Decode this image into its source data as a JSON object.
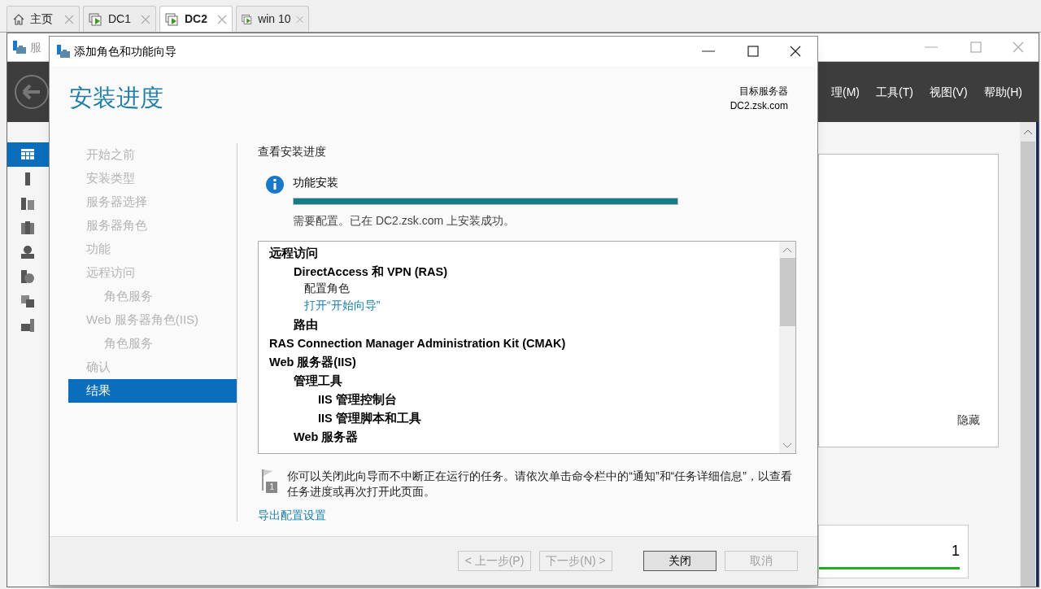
{
  "tabs": [
    {
      "label": "主页",
      "kind": "home",
      "selected": false
    },
    {
      "label": "DC1",
      "kind": "vm",
      "selected": false
    },
    {
      "label": "DC2",
      "kind": "vm",
      "selected": true
    },
    {
      "label": "win 10",
      "kind": "vm",
      "selected": false
    }
  ],
  "background_window": {
    "title": "服",
    "menu": [
      "理(M)",
      "工具(T)",
      "视图(V)",
      "帮助(H)"
    ],
    "sidebar": [
      {
        "kind": "dashboard",
        "selected": true
      },
      {
        "kind": "server",
        "selected": false
      },
      {
        "kind": "servers",
        "selected": false
      },
      {
        "kind": "ad",
        "selected": false
      },
      {
        "kind": "dns",
        "selected": false
      },
      {
        "kind": "iis",
        "selected": false
      },
      {
        "kind": "files",
        "selected": false
      },
      {
        "kind": "remote",
        "selected": false
      }
    ],
    "card_link": "隐藏",
    "count_tile": {
      "value": "1",
      "level": 1
    }
  },
  "wizard": {
    "title": "添加角色和功能向导",
    "heading": "安装进度",
    "target_label": "目标服务器",
    "target_server": "DC2.zsk.com",
    "steps": [
      {
        "label": "开始之前",
        "selected": false
      },
      {
        "label": "安装类型",
        "selected": false
      },
      {
        "label": "服务器选择",
        "selected": false
      },
      {
        "label": "服务器角色",
        "selected": false
      },
      {
        "label": "功能",
        "selected": false
      },
      {
        "label": "远程访问",
        "selected": false,
        "children": [
          {
            "label": "角色服务",
            "selected": false
          }
        ]
      },
      {
        "label": "Web 服务器角色(IIS)",
        "selected": false,
        "children": [
          {
            "label": "角色服务",
            "selected": false
          }
        ]
      },
      {
        "label": "确认",
        "selected": false
      },
      {
        "label": "结果",
        "selected": true
      }
    ],
    "section_title": "查看安装进度",
    "progress": {
      "label": "功能安装",
      "level": 1,
      "message": "需要配置。已在 DC2.zsk.com 上安装成功。"
    },
    "results": [
      {
        "text": "远程访问",
        "kind": "bold",
        "children": [
          {
            "text": "DirectAccess 和 VPN (RAS)",
            "kind": "bold",
            "children": [
              {
                "text": "配置角色",
                "kind": "text"
              },
              {
                "text": "打开“开始向导”",
                "kind": "link"
              }
            ]
          },
          {
            "text": "路由",
            "kind": "bold"
          }
        ]
      },
      {
        "text": "RAS Connection Manager Administration Kit (CMAK)",
        "kind": "bold"
      },
      {
        "text": "Web 服务器(IIS)",
        "kind": "bold",
        "children": [
          {
            "text": "管理工具",
            "kind": "bold",
            "children": [
              {
                "text": "IIS 管理控制台",
                "kind": "bold"
              },
              {
                "text": "IIS 管理脚本和工具",
                "kind": "bold"
              }
            ]
          },
          {
            "text": "Web 服务器",
            "kind": "bold"
          }
        ]
      }
    ],
    "notice": {
      "badge": "1",
      "text": "你可以关闭此向导而不中断正在运行的任务。请依次单击命令栏中的“通知”和“任务详细信息”，以查看任务进度或再次打开此页面。"
    },
    "export_link": "导出配置设置",
    "buttons": [
      {
        "label": "< 上一步(P)",
        "disabled": true,
        "default": false
      },
      {
        "label": "下一步(N) >",
        "disabled": true,
        "default": false
      },
      {
        "label": "关闭",
        "disabled": false,
        "default": true
      },
      {
        "label": "取消",
        "disabled": true,
        "default": false
      }
    ]
  }
}
